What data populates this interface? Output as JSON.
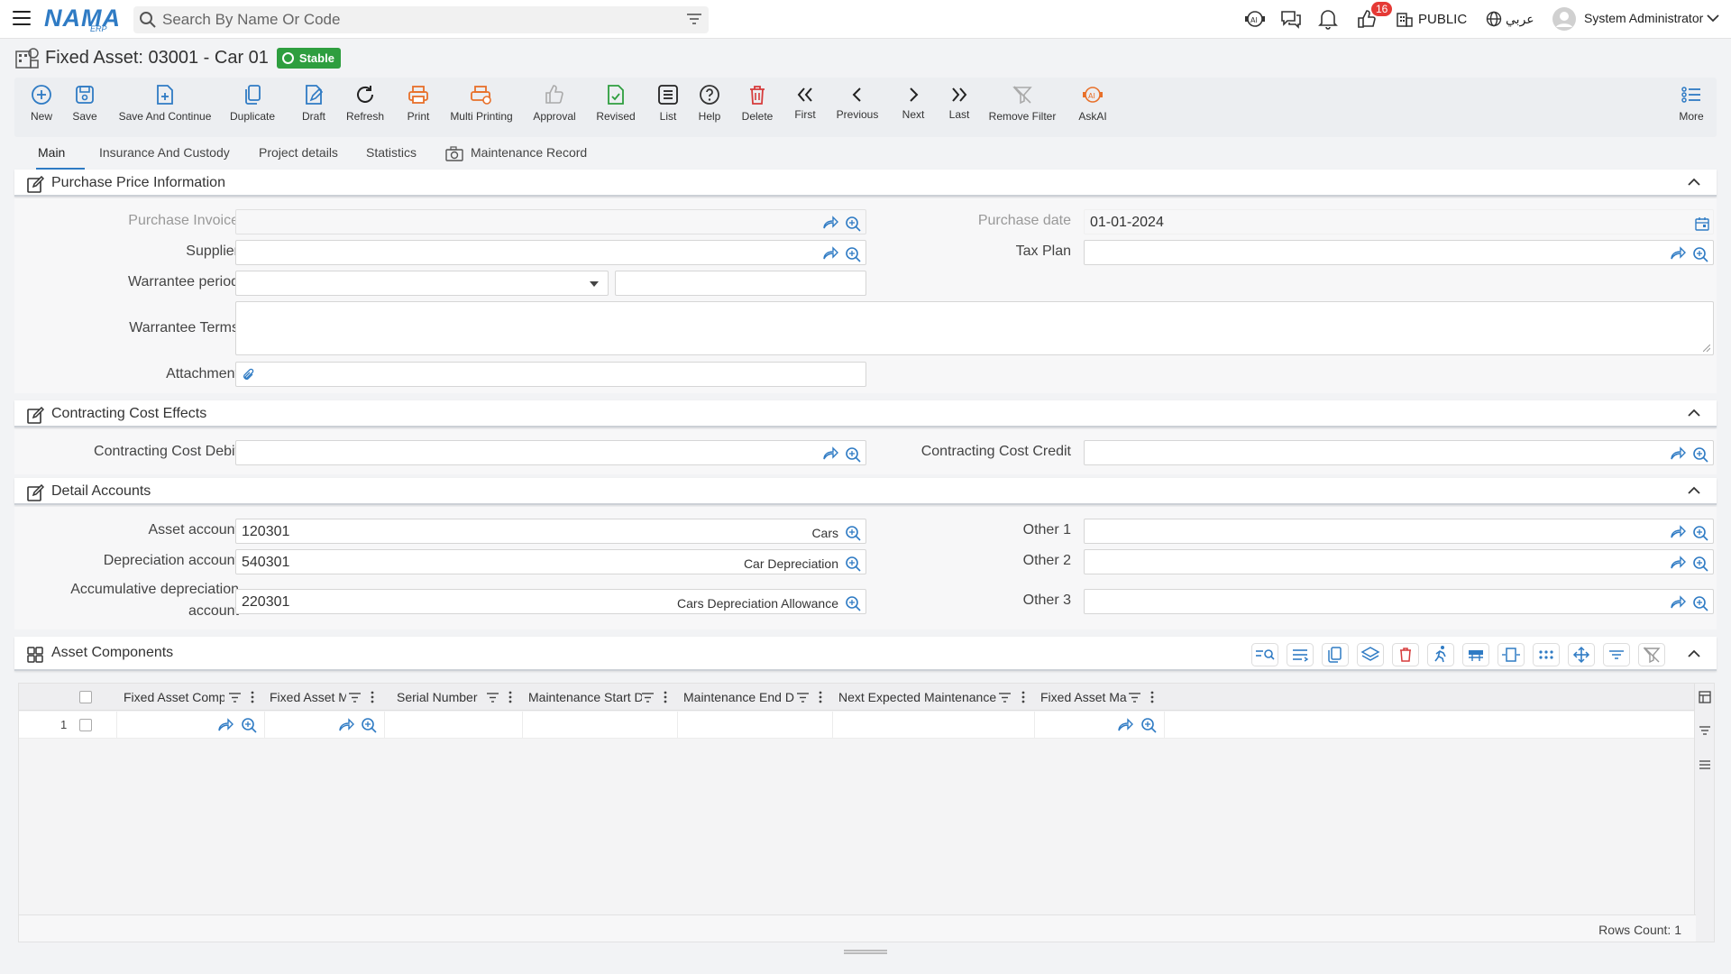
{
  "search": {
    "placeholder": "Search By Name Or Code"
  },
  "header": {
    "logo": "NAMA",
    "logo_sub": "ERP",
    "notifications_count": "16",
    "company": "PUBLIC",
    "language": "عربي",
    "user": "System Administrator"
  },
  "page": {
    "title": "Fixed Asset: 03001 - Car 01",
    "status": "Stable"
  },
  "toolbar": {
    "new": "New",
    "save": "Save",
    "save_continue": "Save And Continue",
    "duplicate": "Duplicate",
    "draft": "Draft",
    "refresh": "Refresh",
    "print": "Print",
    "multi_printing": "Multi Printing",
    "approval": "Approval",
    "revised": "Revised",
    "list": "List",
    "help": "Help",
    "delete": "Delete",
    "first": "First",
    "previous": "Previous",
    "next": "Next",
    "last": "Last",
    "remove_filter": "Remove Filter",
    "askai": "AskAI",
    "more": "More"
  },
  "tabs": {
    "main": "Main",
    "insurance": "Insurance And Custody",
    "project": "Project details",
    "statistics": "Statistics",
    "maintenance": "Maintenance Record"
  },
  "purchase": {
    "section_title": "Purchase Price Information",
    "invoice_label": "Purchase Invoice",
    "supplier_label": "Supplier",
    "warranty_period_label": "Warrantee period",
    "warranty_terms_label": "Warrantee Terms",
    "attachment_label": "Attachment",
    "date_label": "Purchase date",
    "date_value": "01-01-2024",
    "tax_plan_label": "Tax Plan"
  },
  "contracting": {
    "section_title": "Contracting Cost Effects",
    "debit_label": "Contracting Cost Debit",
    "credit_label": "Contracting Cost Credit"
  },
  "detail": {
    "section_title": "Detail Accounts",
    "asset_label": "Asset account",
    "asset_code": "120301",
    "asset_name": "Cars",
    "dep_label": "Depreciation account",
    "dep_code": "540301",
    "dep_name": "Car Depreciation",
    "accdep_label_1": "Accumulative depreciation",
    "accdep_label_2": "account",
    "accdep_code": "220301",
    "accdep_name": "Cars Depreciation Allowance",
    "other1_label": "Other 1",
    "other2_label": "Other 2",
    "other3_label": "Other 3"
  },
  "components": {
    "section_title": "Asset Components",
    "columns": [
      "Fixed Asset Comp",
      "Fixed Asset M",
      "Serial Number",
      "Maintenance Start D",
      "Maintenance End D",
      "Next Expected Maintenance",
      "Fixed Asset Ma"
    ],
    "row_number": "1",
    "rows_count": "Rows Count: 1"
  }
}
